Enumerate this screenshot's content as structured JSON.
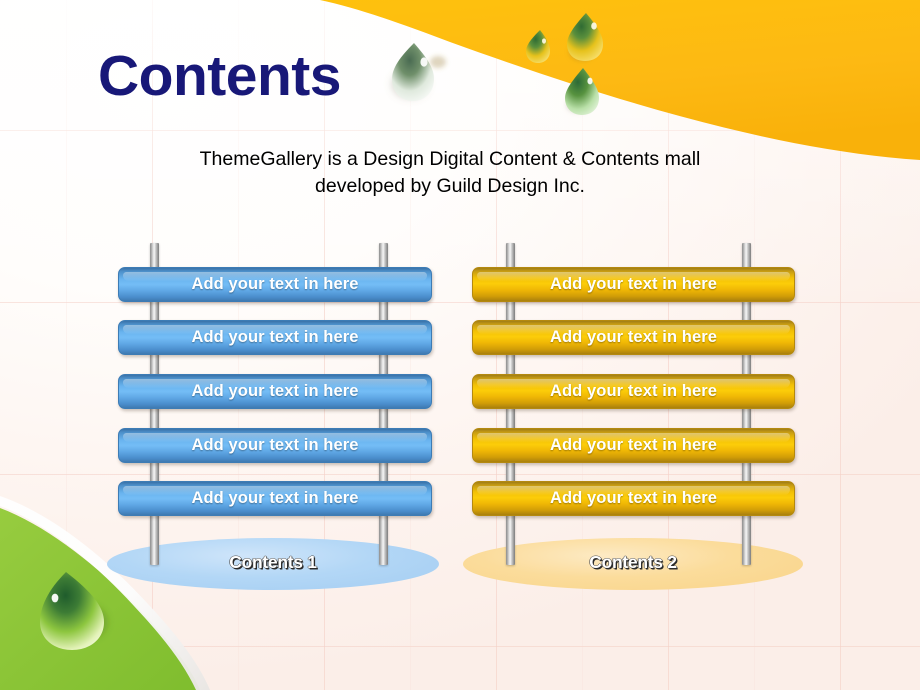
{
  "slide": {
    "title": "Contents",
    "subtitle_line1": "ThemeGallery  is a Design Digital Content & Contents mall",
    "subtitle_line2": "developed by Guild Design Inc.",
    "title_color": "#181878",
    "background_color": "#fffaf7"
  },
  "decor": {
    "top_right_shape_color": "#fdb913",
    "bottom_left_shape_color": "#8cc63e",
    "droplet_names": [
      "water-droplet-large",
      "water-droplet-small",
      "water-droplet-medium",
      "water-droplet-lower",
      "water-droplet-green"
    ]
  },
  "columns": [
    {
      "id": "contents-1",
      "accent_color": "#4a96d8",
      "ellipse_color": "#aed4f5",
      "footer_label": "Contents 1",
      "bars": [
        {
          "label": "Add your text in here"
        },
        {
          "label": "Add your text in here"
        },
        {
          "label": "Add your text in here"
        },
        {
          "label": "Add your text in here"
        },
        {
          "label": "Add your text in here"
        }
      ]
    },
    {
      "id": "contents-2",
      "accent_color": "#f0b400",
      "ellipse_color": "#fbdc9b",
      "footer_label": "Contents 2",
      "bars": [
        {
          "label": "Add your text in here"
        },
        {
          "label": "Add your text in here"
        },
        {
          "label": "Add your text in here"
        },
        {
          "label": "Add your text in here"
        },
        {
          "label": "Add your text in here"
        }
      ]
    }
  ]
}
